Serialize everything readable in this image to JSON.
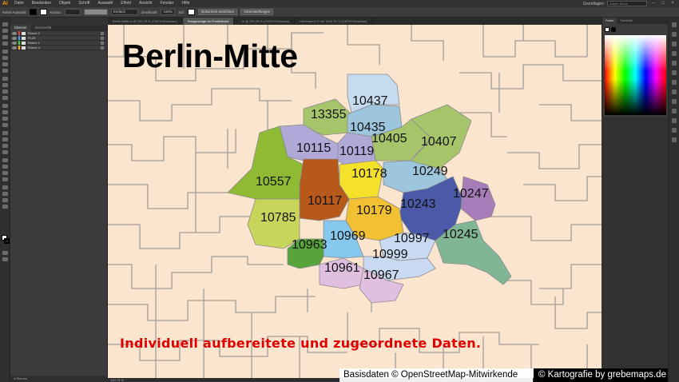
{
  "menubar": {
    "items": [
      "Datei",
      "Bearbeiten",
      "Objekt",
      "Schrift",
      "Auswahl",
      "Effekt",
      "Ansicht",
      "Fenster",
      "Hilfe"
    ],
    "workspace": "Grundlagen",
    "search_placeholder": "Adobe Stock durchsuchen"
  },
  "controlbar": {
    "selection": "Keine Auswahl",
    "stroke_label": "Kontur:",
    "brush": "Einfach",
    "opacity_label": "Deckkraft:",
    "opacity_value": "100%",
    "style_label": "Stil:",
    "doc_setup": "Dokument einrichten",
    "prefs": "Voreinstellungen"
  },
  "tabs": [
    {
      "label": "Berlin-Mitte.ai @ 200,28 % (CMYK/Vorschau)",
      "active": false
    },
    {
      "label": "Ranganzeige bei Postleitzahl",
      "active": true
    },
    {
      "label": "...ai @ 200,28 % (CMYK/Vorschau)",
      "active": false
    },
    {
      "label": "Unbenannt-1* bei 1198,78 % (CMYK/Vorschau)",
      "active": false
    }
  ],
  "layers_panel": {
    "tabs": [
      "Ebenen",
      "Zeichenflä"
    ],
    "rows": [
      {
        "name": "Ebene 2",
        "color": "#ff3c3c"
      },
      {
        "name": "PLZ5",
        "color": "#3ca0ff"
      },
      {
        "name": "Ebene 1",
        "color": "#3cd23c"
      },
      {
        "name": "Ebene 4",
        "color": "#ffb400"
      }
    ],
    "footer": "4 Ebenen"
  },
  "status": "190,78 %",
  "map": {
    "title": "Berlin-Mitte",
    "subtitle": "Individuell aufbereitete und zugeordnete Daten.",
    "postcodes": [
      "10437",
      "13355",
      "10435",
      "10405",
      "10407",
      "10115",
      "10119",
      "10557",
      "10178",
      "10249",
      "10117",
      "10243",
      "10247",
      "10785",
      "10179",
      "10969",
      "10997",
      "10245",
      "10963",
      "10999",
      "10961",
      "10967"
    ]
  },
  "credits": {
    "source": "Basisdaten © OpenStreetMap-Mitwirkende",
    "cartography": "© Kartografie by grebemaps.de"
  },
  "color_panel": {
    "tabs": [
      "Farbe",
      "Farbhilfe"
    ]
  }
}
